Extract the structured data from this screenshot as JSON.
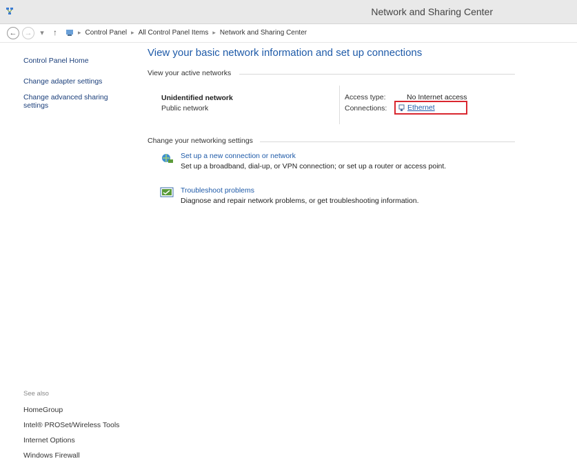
{
  "window": {
    "title": "Network and Sharing Center"
  },
  "address_bar": {
    "crumbs": [
      "Control Panel",
      "All Control Panel Items",
      "Network and Sharing Center"
    ]
  },
  "sidebar": {
    "home": "Control Panel Home",
    "change_adapter": "Change adapter settings",
    "change_advanced": "Change advanced sharing settings",
    "see_also_heading": "See also",
    "see_also": [
      "HomeGroup",
      "Intel® PROSet/Wireless Tools",
      "Internet Options",
      "Windows Firewall"
    ]
  },
  "main": {
    "heading": "View your basic network information and set up connections",
    "active_networks_label": "View your active networks",
    "network": {
      "name": "Unidentified network",
      "type": "Public network",
      "access_type_label": "Access type:",
      "access_type_value": "No Internet access",
      "connections_label": "Connections:",
      "connection_value": "Ethernet"
    },
    "change_settings_label": "Change your networking settings",
    "tasks": [
      {
        "link": "Set up a new connection or network",
        "desc": "Set up a broadband, dial-up, or VPN connection; or set up a router or access point."
      },
      {
        "link": "Troubleshoot problems",
        "desc": "Diagnose and repair network problems, or get troubleshooting information."
      }
    ]
  },
  "colors": {
    "link": "#1e5aa8",
    "highlight": "#d9262e"
  }
}
